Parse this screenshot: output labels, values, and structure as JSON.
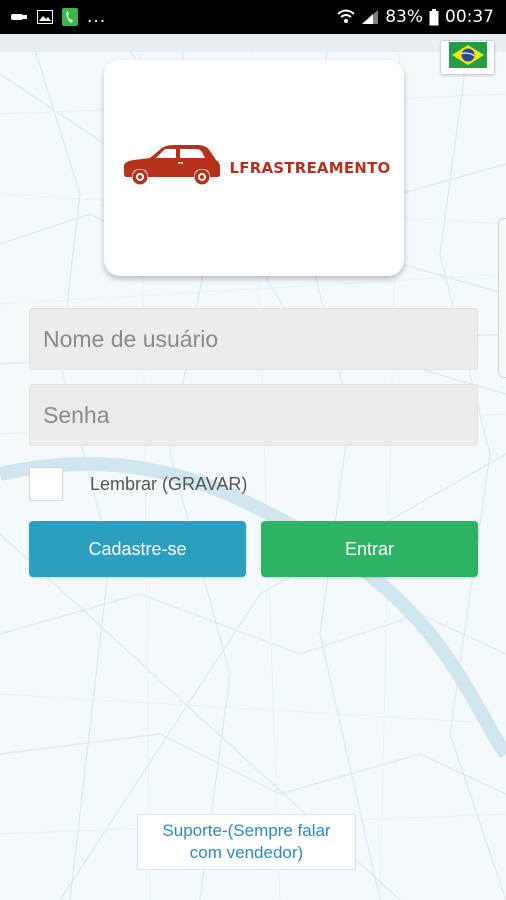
{
  "status_bar": {
    "battery": "83%",
    "time": "00:37",
    "more_indicator": "...",
    "icons": [
      "cast-icon",
      "image-icon",
      "phone-icon",
      "wifi-icon",
      "signal-icon",
      "battery-icon"
    ]
  },
  "header": {
    "language_flag": "brazil-flag-icon"
  },
  "logo": {
    "brand_name": "LFRASTREAMENTO",
    "icon": "car-icon",
    "color": "#b5311a"
  },
  "login_form": {
    "username_placeholder": "Nome de usuário",
    "password_placeholder": "Senha",
    "remember_label": "Lembrar (GRAVAR)",
    "remember_checked": false
  },
  "actions": {
    "signup_label": "Cadastre-se",
    "login_label": "Entrar",
    "signup_color": "#2c9fc0",
    "login_color": "#2eb365"
  },
  "support": {
    "line1": "Suporte-(Sempre falar",
    "line2": "com vendedor)"
  }
}
